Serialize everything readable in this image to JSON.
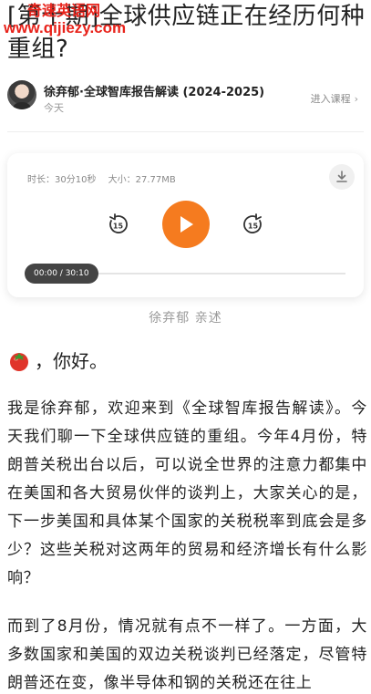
{
  "watermark": {
    "line1": "奇速英语网",
    "line2": "www.qijiezy.com"
  },
  "article": {
    "title": "[第十期]全球供应链正在经历何种重组?"
  },
  "author": {
    "name": "徐弃郁·全球智库报告解读 (2024-2025)",
    "date": "今天",
    "enter_course_label": "进入课程",
    "avatar_icon": "avatar-photo"
  },
  "player": {
    "duration_label": "时长：30分10秒",
    "size_label": "大小：27.77MB",
    "download_icon": "download-icon",
    "rewind_icon": "rewind-15-icon",
    "play_icon": "play-icon",
    "forward_icon": "forward-15-icon",
    "time_display": "00:00 / 30:10",
    "progress": 0,
    "accent_color": "#f57b1f"
  },
  "narrator": "徐弃郁 亲述",
  "greeting": {
    "icon": "tomato-icon",
    "text": "，你好。"
  },
  "paragraphs": [
    "我是徐弃郁，欢迎来到《全球智库报告解读》。今天我们聊一下全球供应链的重组。今年4月份，特朗普关税出台以后，可以说全世界的注意力都集中在美国和各大贸易伙伴的谈判上，大家关心的是，下一步美国和具体某个国家的关税税率到底会是多少？这些关税对这两年的贸易和经济增长有什么影响？",
    "而到了8月份，情况就有点不一样了。一方面，大多数国家和美国的双边关税谈判已经落定，尽管特朗普还在变，像半导体和钢的关税还在往上"
  ]
}
